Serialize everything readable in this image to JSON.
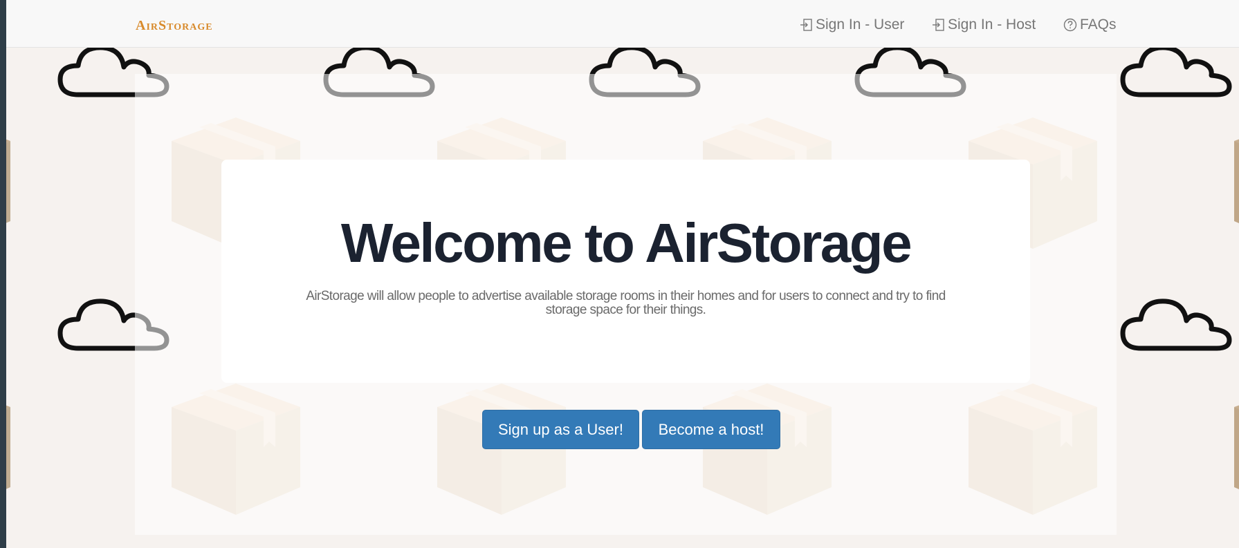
{
  "navbar": {
    "brand": "AirStorage",
    "links": [
      {
        "label": "Sign In - User",
        "icon": "log-in-icon"
      },
      {
        "label": "Sign In - Host",
        "icon": "log-in-icon"
      },
      {
        "label": "FAQs",
        "icon": "question-circle-icon"
      }
    ]
  },
  "hero": {
    "title": "Welcome to AirStorage",
    "lead": "AirStorage will allow people to advertise available storage rooms in their homes and for users to connect and try to find storage space for their things."
  },
  "actions": {
    "signup_user": "Sign up as a User!",
    "become_host": "Become a host!"
  },
  "colors": {
    "brand": "#d88a2b",
    "primary_button": "#337ab7",
    "title": "#1b2230",
    "background": "#f6f2ef"
  },
  "background_pattern": {
    "icons": [
      "cloud-icon",
      "cardboard-box-icon"
    ]
  }
}
